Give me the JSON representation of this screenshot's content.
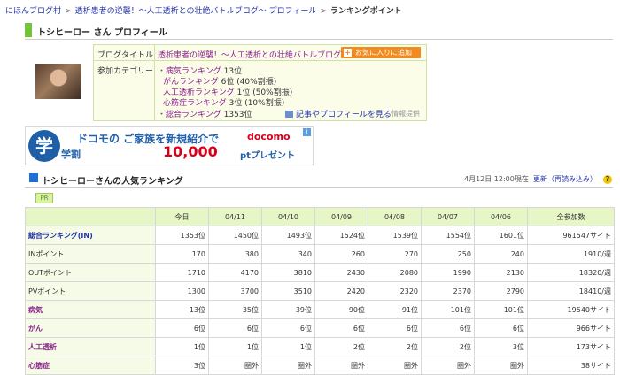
{
  "breadcrumb": {
    "items": [
      "にほんブログ村",
      "透析患者の逆襲！〜人工透析との壮絶バトルブログ〜 プロフィール"
    ],
    "current": "ランキングポイント"
  },
  "profile": {
    "title": "トシヒーロー さん プロフィール",
    "blog_title_label": "ブログタイトル",
    "blog_title": "透析患者の逆襲！〜人工透析との壮絶バトルブログ〜",
    "category_label": "参加カテゴリー",
    "categories": [
      {
        "name": "病気ランキング",
        "rank": "13位"
      },
      {
        "name": "がんランキング",
        "rank": "6位 (40%割振)"
      },
      {
        "name": "人工透析ランキング",
        "rank": "1位 (50%割振)"
      },
      {
        "name": "心筋症ランキング",
        "rank": "3位 (10%割振)"
      },
      {
        "name": "総合ランキング",
        "rank": "1353位"
      }
    ],
    "fav_button": "お気に入りに追加",
    "article_link": "記事やプロフィールを見る",
    "info_provided": "情報提供"
  },
  "banner": {
    "logo": "学",
    "logo_sub": "学割",
    "line1": "ドコモの ご家族を新規紹介で",
    "brand": "docomo",
    "line2_amount": "10,000",
    "line2_unit": "ptプレゼント",
    "ad_icon": "i"
  },
  "ranking": {
    "title": "トシヒーローさんの人気ランキング",
    "date": "4月12日 12:00現在",
    "refresh": "更新（再読み込み）",
    "help": "?",
    "pr": "PR",
    "headers": [
      "",
      "今日",
      "04/11",
      "04/10",
      "04/09",
      "04/08",
      "04/07",
      "04/06",
      "全参加数"
    ],
    "rows": [
      {
        "name": "総合ランキング(IN)",
        "kind": "main",
        "cells": [
          "1353位",
          "1450位",
          "1493位",
          "1524位",
          "1539位",
          "1554位",
          "1601位",
          "961547サイト"
        ]
      },
      {
        "name": "INポイント",
        "kind": "plain",
        "cells": [
          "170",
          "380",
          "340",
          "260",
          "270",
          "250",
          "240",
          "1910/週"
        ]
      },
      {
        "name": "OUTポイント",
        "kind": "plain",
        "cells": [
          "1710",
          "4170",
          "3810",
          "2430",
          "2080",
          "1990",
          "2130",
          "18320/週"
        ]
      },
      {
        "name": "PVポイント",
        "kind": "plain",
        "cells": [
          "1300",
          "3700",
          "3510",
          "2420",
          "2320",
          "2370",
          "2790",
          "18410/週"
        ]
      },
      {
        "name": "病気",
        "kind": "cat",
        "cells": [
          "13位",
          "35位",
          "39位",
          "90位",
          "91位",
          "101位",
          "101位",
          "19540サイト"
        ]
      },
      {
        "name": "がん",
        "kind": "cat",
        "cells": [
          "6位",
          "6位",
          "6位",
          "6位",
          "6位",
          "6位",
          "6位",
          "966サイト"
        ]
      },
      {
        "name": "人工透析",
        "kind": "cat",
        "cells": [
          "1位",
          "1位",
          "1位",
          "2位",
          "2位",
          "2位",
          "3位",
          "173サイト"
        ]
      },
      {
        "name": "心筋症",
        "kind": "cat",
        "cells": [
          "3位",
          "圏外",
          "圏外",
          "圏外",
          "圏外",
          "圏外",
          "圏外",
          "38サイト"
        ]
      }
    ]
  }
}
